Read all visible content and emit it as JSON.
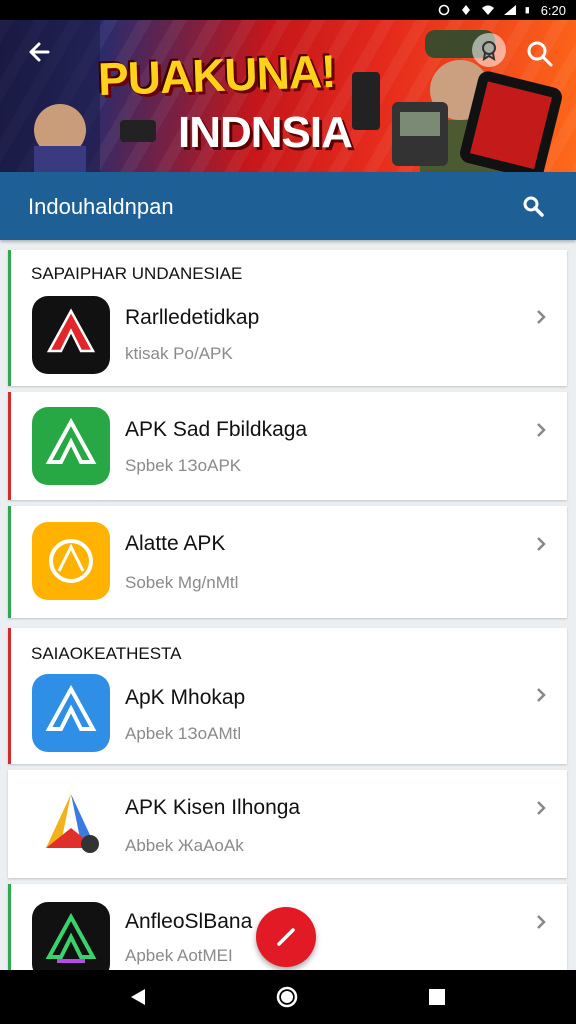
{
  "status_bar": {
    "time": "6:20",
    "icons": [
      "sync-icon",
      "location-icon",
      "wifi-icon",
      "signal-icon",
      "battery-icon"
    ]
  },
  "banner": {
    "title_line1": "PUAKUNA!",
    "title_line2": "INDNSIA"
  },
  "toolbar": {
    "title": "Indouhaldnpan"
  },
  "sections": [
    {
      "header": "SAPAIPHAR UNDANESIAE",
      "items": [
        {
          "name": "Rarlledetidkap",
          "subtitle": "ktisak Po/APK",
          "icon": "red-apk-app-icon",
          "icon_bg": "#111111"
        },
        {
          "name": "APK Sad Fbildkaga",
          "subtitle": "Spbek 1ЗoAPK",
          "icon": "green-apk-app-icon",
          "icon_bg": "#27a844"
        },
        {
          "name": "Alatte APK",
          "subtitle": "Sobek Mg/nMtl",
          "icon": "yellow-apk-app-icon",
          "icon_bg": "#ffb300"
        }
      ]
    },
    {
      "header": "SAIAOKEATHESTA",
      "items": [
        {
          "name": "ApK Mhokap",
          "subtitle": "Apbek 1ЗoAMtl",
          "icon": "blue-apk-app-icon",
          "icon_bg": "#2f8fe6"
        },
        {
          "name": "APK Kisen Ilhonga",
          "subtitle": "Abbek ЖaAoAk",
          "icon": "multicolor-apk-app-icon",
          "icon_bg": "#ffffff"
        },
        {
          "name": "AnfleoSlBana",
          "subtitle": "Apbek AotMEI",
          "icon": "neon-apk-app-icon",
          "icon_bg": "#111111"
        }
      ]
    }
  ],
  "colors": {
    "toolbar": "#1e5f95",
    "fab": "#e21a26",
    "accent_red": "#d62b2b",
    "accent_green": "#2fa84f"
  }
}
